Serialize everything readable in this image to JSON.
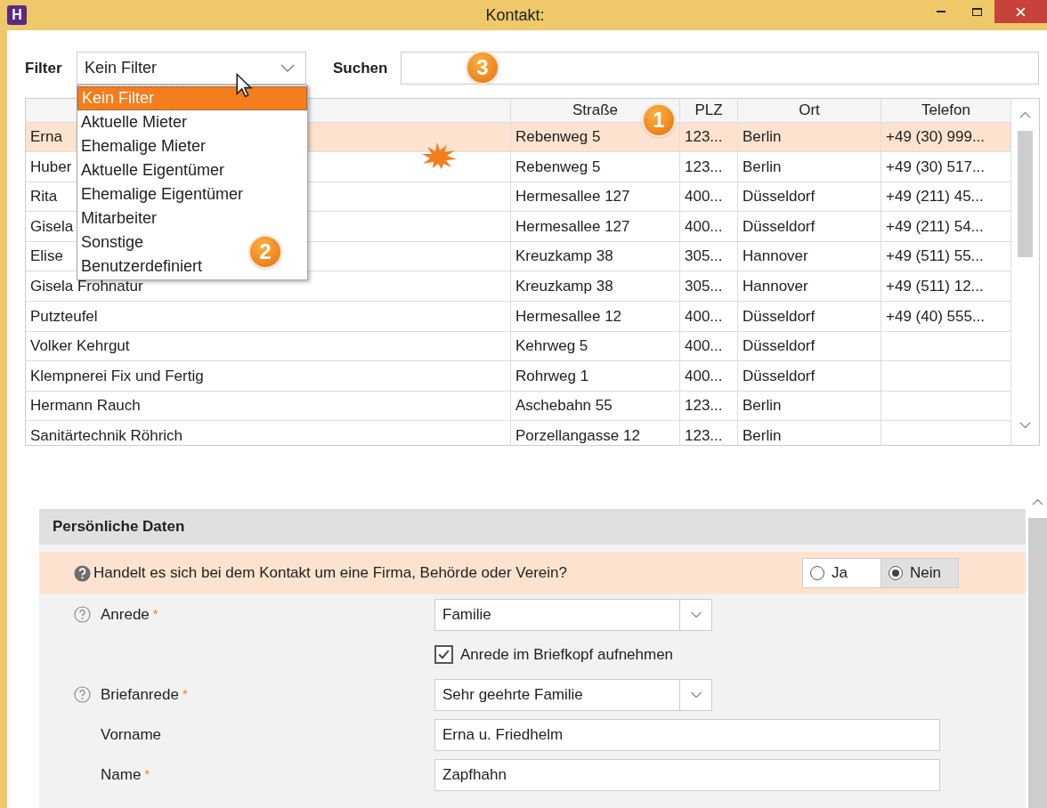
{
  "window": {
    "app_icon": "H",
    "title": "Kontakt:"
  },
  "filter": {
    "label": "Filter",
    "value": "Kein Filter",
    "open": true,
    "options": [
      {
        "label": "Kein Filter",
        "selected": true
      },
      {
        "label": "Aktuelle Mieter",
        "selected": false
      },
      {
        "label": "Ehemalige Mieter",
        "selected": false
      },
      {
        "label": "Aktuelle Eigentümer",
        "selected": false
      },
      {
        "label": "Ehemalige Eigentümer",
        "selected": false
      },
      {
        "label": "Mitarbeiter",
        "selected": false
      },
      {
        "label": "Sonstige",
        "selected": false
      },
      {
        "label": "Benutzerdefiniert",
        "selected": false
      }
    ]
  },
  "search": {
    "label": "Suchen"
  },
  "markers": [
    "1",
    "2",
    "3"
  ],
  "table": {
    "columns": [
      "",
      "Straße",
      "PLZ",
      "Ort",
      "Telefon"
    ],
    "rows": [
      {
        "selected": true,
        "cells": [
          "Erna",
          "Rebenweg 5",
          "123...",
          "Berlin",
          "+49 (30) 999..."
        ]
      },
      {
        "selected": false,
        "cells": [
          "Huber",
          "Rebenweg 5",
          "123...",
          "Berlin",
          "+49 (30) 517..."
        ]
      },
      {
        "selected": false,
        "cells": [
          "Rita",
          "Hermesallee 127",
          "400...",
          "Düsseldorf",
          "+49 (211) 45..."
        ]
      },
      {
        "selected": false,
        "cells": [
          "Gisela",
          "Hermesallee 127",
          "400...",
          "Düsseldorf",
          "+49 (211) 54..."
        ]
      },
      {
        "selected": false,
        "cells": [
          "Elise",
          "Kreuzkamp 38",
          "305...",
          "Hannover",
          "+49 (511) 55..."
        ]
      },
      {
        "selected": false,
        "cells": [
          "Gisela Frohnatur",
          "Kreuzkamp 38",
          "305...",
          "Hannover",
          "+49 (511) 12..."
        ]
      },
      {
        "selected": false,
        "cells": [
          "Putzteufel",
          "Hermesallee 12",
          "400...",
          "Düsseldorf",
          "+49 (40) 555..."
        ]
      },
      {
        "selected": false,
        "cells": [
          "Volker Kehrgut",
          "Kehrweg 5",
          "400...",
          "Düsseldorf"
        ]
      },
      {
        "selected": false,
        "cells": [
          "Klempnerei Fix und Fertig",
          "Rohrweg 1",
          "400...",
          "Düsseldorf"
        ]
      },
      {
        "selected": false,
        "cells": [
          "Hermann Rauch",
          "Aschebahn 55",
          "123...",
          "Berlin"
        ]
      },
      {
        "selected": false,
        "cells": [
          "Sanitärtechnik Röhrich",
          "Porzellangasse 12",
          "123...",
          "Berlin"
        ]
      }
    ]
  },
  "form": {
    "title": "Persönliche Daten",
    "question": {
      "text": "Handelt es sich bei dem Kontakt um eine Firma, Behörde oder Verein?",
      "options": [
        {
          "label": "Ja",
          "selected": false
        },
        {
          "label": "Nein",
          "selected": true
        }
      ]
    },
    "fields": [
      {
        "kind": "select",
        "help": true,
        "label": "Anrede",
        "required_mark": "*",
        "value": "Familie"
      },
      {
        "kind": "checkbox",
        "label": "Anrede im Briefkopf aufnehmen",
        "checked": true
      },
      {
        "kind": "select",
        "help": true,
        "label": "Briefanrede",
        "required_mark": "*",
        "value": "Sehr geehrte Familie"
      },
      {
        "kind": "text",
        "help": false,
        "label": "Vorname",
        "value": "Erna u. Friedhelm"
      },
      {
        "kind": "text",
        "help": false,
        "label": "Name",
        "required_mark": "*",
        "value": "Zapfhahn"
      }
    ]
  }
}
